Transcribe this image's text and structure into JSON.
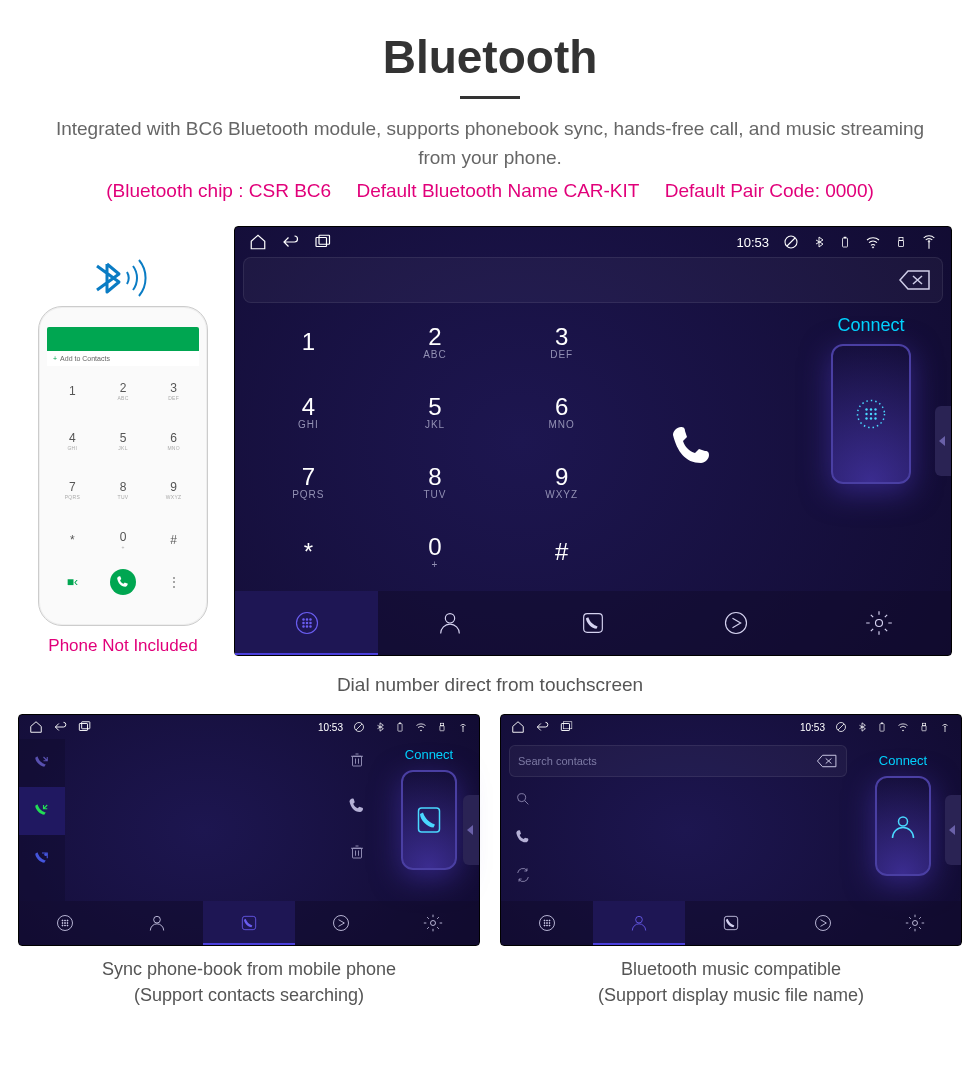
{
  "header": {
    "title": "Bluetooth",
    "subtitle": "Integrated with BC6 Bluetooth module, supports phonebook sync, hands-free call, and music streaming from your phone.",
    "spec_chip": "(Bluetooth chip : CSR BC6",
    "spec_name": "Default Bluetooth Name CAR-KIT",
    "spec_code": "Default Pair Code: 0000)"
  },
  "phone": {
    "add_contacts": "Add to Contacts",
    "caption": "Phone Not Included",
    "keys": [
      {
        "n": "1",
        "l": ""
      },
      {
        "n": "2",
        "l": "ABC"
      },
      {
        "n": "3",
        "l": "DEF"
      },
      {
        "n": "4",
        "l": "GHI"
      },
      {
        "n": "5",
        "l": "JKL"
      },
      {
        "n": "6",
        "l": "MNO"
      },
      {
        "n": "7",
        "l": "PQRS"
      },
      {
        "n": "8",
        "l": "TUV"
      },
      {
        "n": "9",
        "l": "WXYZ"
      },
      {
        "n": "*",
        "l": ""
      },
      {
        "n": "0",
        "l": "+"
      },
      {
        "n": "#",
        "l": ""
      }
    ]
  },
  "status": {
    "time": "10:53"
  },
  "device_main": {
    "connect": "Connect",
    "keys": [
      {
        "n": "1",
        "l": ""
      },
      {
        "n": "2",
        "l": "ABC"
      },
      {
        "n": "3",
        "l": "DEF"
      },
      {
        "n": "4",
        "l": "GHI"
      },
      {
        "n": "5",
        "l": "JKL"
      },
      {
        "n": "6",
        "l": "MNO"
      },
      {
        "n": "7",
        "l": "PQRS"
      },
      {
        "n": "8",
        "l": "TUV"
      },
      {
        "n": "9",
        "l": "WXYZ"
      },
      {
        "n": "*",
        "l": ""
      },
      {
        "n": "0",
        "l": "+"
      },
      {
        "n": "#",
        "l": ""
      }
    ],
    "caption": "Dial number direct from touchscreen"
  },
  "device_log": {
    "connect": "Connect",
    "caption_line1": "Sync phone-book from mobile phone",
    "caption_line2": "(Support contacts searching)"
  },
  "device_cts": {
    "connect": "Connect",
    "search_placeholder": "Search contacts",
    "caption_line1": "Bluetooth music compatible",
    "caption_line2": "(Support display music file name)"
  }
}
